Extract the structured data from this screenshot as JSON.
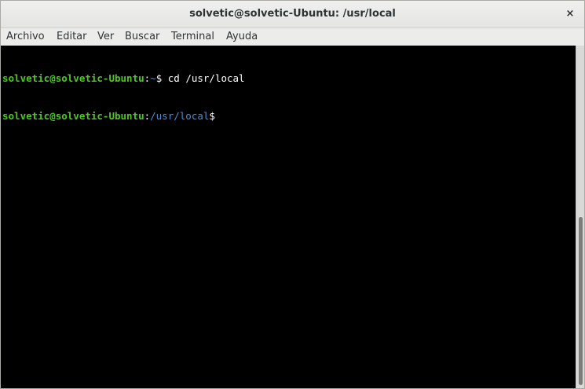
{
  "window": {
    "title": "solvetic@solvetic-Ubuntu: /usr/local",
    "close_glyph": "×"
  },
  "menu": [
    "Archivo",
    "Editar",
    "Ver",
    "Buscar",
    "Terminal",
    "Ayuda"
  ],
  "terminal": {
    "lines": [
      {
        "user": "solvetic@solvetic-Ubuntu",
        "sep": ":",
        "path": "~",
        "prompt": "$ ",
        "command": "cd /usr/local"
      },
      {
        "user": "solvetic@solvetic-Ubuntu",
        "sep": ":",
        "path": "/usr/local",
        "prompt": "$",
        "command": ""
      }
    ],
    "colors": {
      "user": "#4ec723",
      "path": "#4c8ed3",
      "text": "#ffffff",
      "background": "#000000"
    }
  },
  "scrollbar": {
    "position_fraction": 0.5
  }
}
